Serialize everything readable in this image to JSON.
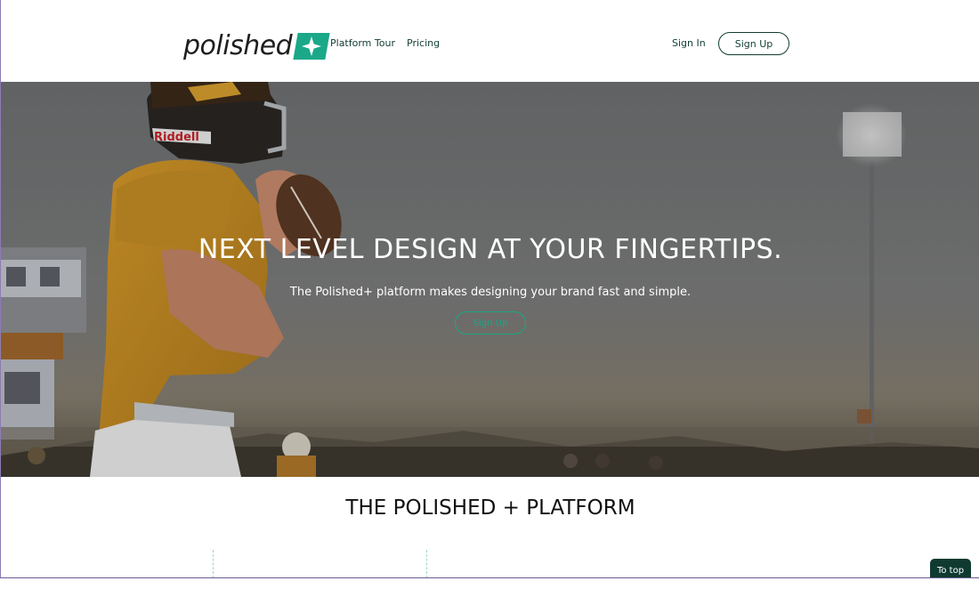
{
  "nav": {
    "logo_text": "polished",
    "links": [
      {
        "label": "Platform Tour"
      },
      {
        "label": "Pricing"
      }
    ],
    "sign_in": "Sign In",
    "sign_up": "Sign Up"
  },
  "hero": {
    "title": "NEXT LEVEL DESIGN AT YOUR FINGERTIPS.",
    "subtitle": "The Polished+ platform makes designing your brand fast and simple.",
    "cta": "Sign Up",
    "helmet_text": "Riddell"
  },
  "section": {
    "title": "THE POLISHED + PLATFORM"
  },
  "to_top": "To top",
  "colors": {
    "brand": "#1aa889",
    "dark_green": "#113d33",
    "to_top_bg": "#0f3a30"
  },
  "icons": {
    "logo_badge": "sparkle-plus-icon"
  }
}
